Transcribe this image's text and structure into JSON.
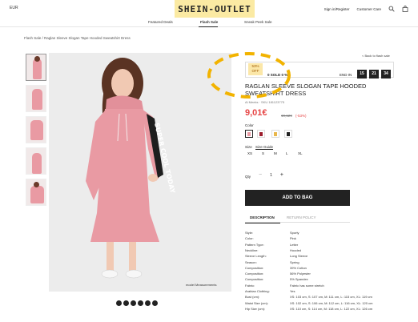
{
  "header": {
    "currency": "EUR",
    "logo": "SHEIN-OUTLET",
    "links": {
      "signin": "Sign in/Register",
      "customer": "Customer Care"
    }
  },
  "nav": {
    "items": [
      "Featured Deals",
      "Flash Sale",
      "Sneak Peek Sale"
    ]
  },
  "breadcrumb": "Flash Sale  /  Raglan Sleeve Slogan Tape Hooded Sweatshirt Dress",
  "image": {
    "model_measurements": "model Measurements"
  },
  "promo": {
    "back": "< Back to flash sale",
    "badge_pct": "53%",
    "badge_off": "OFF",
    "sold": "0 SOLD 0 %",
    "endin": "END IN",
    "timer": [
      "15",
      "21",
      "34"
    ]
  },
  "product": {
    "title": "RAGLAN SLEEVE SLOGAN TAPE HOODED SWEATSHIRT DRESS",
    "sku": "Al Meeks  ·  SKU 181123775",
    "price": "9,01€",
    "old_price": "19,12€",
    "discount": "(-53%)",
    "color_label": "Color",
    "size_label": "Size",
    "size_guide": "Size Guide",
    "sizes": [
      "XS",
      "S",
      "M",
      "L",
      "XL"
    ],
    "qty_label": "Qty",
    "qty_minus": "−",
    "qty_value": "1",
    "qty_plus": "+",
    "add_to_bag": "ADD TO BAG",
    "tabs": [
      "DESCRIPTION",
      "RETURN POLICY"
    ]
  },
  "colors": {
    "accent": "#e64545",
    "brand_bg": "#fbeaa3",
    "highlight": "#f2b300"
  },
  "specs": [
    [
      "Style:",
      "Sporty"
    ],
    [
      "Color:",
      "Pink"
    ],
    [
      "Pattern Type:",
      "Letter"
    ],
    [
      "Neckline:",
      "Hooded"
    ],
    [
      "Sleeve Length:",
      "Long Sleeve"
    ],
    [
      "Season:",
      "Spring"
    ],
    [
      "Composition:",
      "39% Cotton"
    ],
    [
      "Composition:",
      "56% Polyester"
    ],
    [
      "Composition:",
      "5% Spandex"
    ],
    [
      "Fabric:",
      "Fabric has some stretch"
    ],
    [
      "Arabian Clothing:",
      "Yes"
    ],
    [
      "Bust (cm):",
      "XS: 103 cm, S: 107 cm, M: 111 cm, L: 115 cm, XL: 119 cm"
    ],
    [
      "Waist Size (cm):",
      "XS: 102 cm, S: 106 cm, M: 112 cm, L: 116 cm, XL: 120 cm"
    ],
    [
      "Hip Size (cm):",
      "XS: 110 cm, S: 114 cm, M: 118 cm, L: 122 cm, XL: 126 cm"
    ]
  ]
}
